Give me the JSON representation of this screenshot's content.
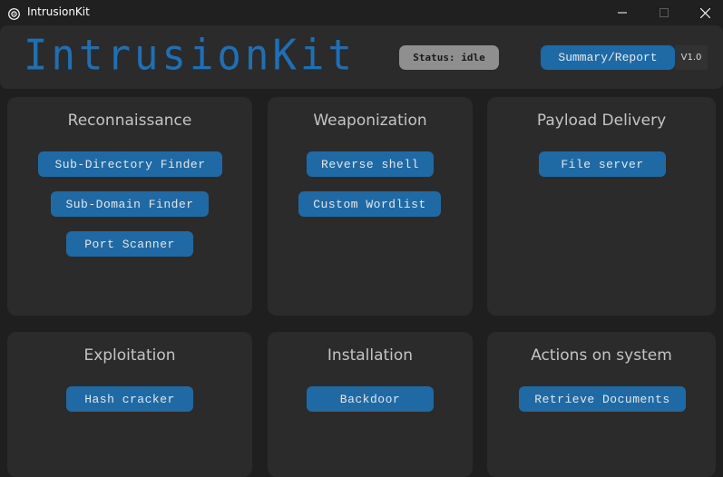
{
  "window": {
    "title": "IntrusionKit",
    "app_icon": "app-logo-icon",
    "controls": [
      "minimize-icon",
      "maximize-icon",
      "close-icon"
    ]
  },
  "header": {
    "logo_text": "IntrusionKit",
    "status_label": "Status:",
    "status_value": "idle",
    "summary_button": "Summary/Report",
    "version": "V1.0"
  },
  "sections": {
    "recon": {
      "title": "Reconnaissance",
      "buttons": [
        "Sub-Directory Finder",
        "Sub-Domain Finder",
        "Port Scanner"
      ]
    },
    "weapon": {
      "title": "Weaponization",
      "buttons": [
        "Reverse shell",
        "Custom Wordlist"
      ]
    },
    "payload": {
      "title": "Payload Delivery",
      "buttons": [
        "File server"
      ]
    },
    "exploit": {
      "title": "Exploitation",
      "buttons": [
        "Hash cracker"
      ]
    },
    "install": {
      "title": "Installation",
      "buttons": [
        "Backdoor"
      ]
    },
    "actions": {
      "title": "Actions on system",
      "buttons": [
        "Retrieve Documents"
      ]
    }
  },
  "colors": {
    "accent": "#1f6aa5",
    "background": "#1f1f1f",
    "panel": "#2b2b2b",
    "status_pill": "#8f8f8f",
    "logo": "#1f6fb5"
  }
}
